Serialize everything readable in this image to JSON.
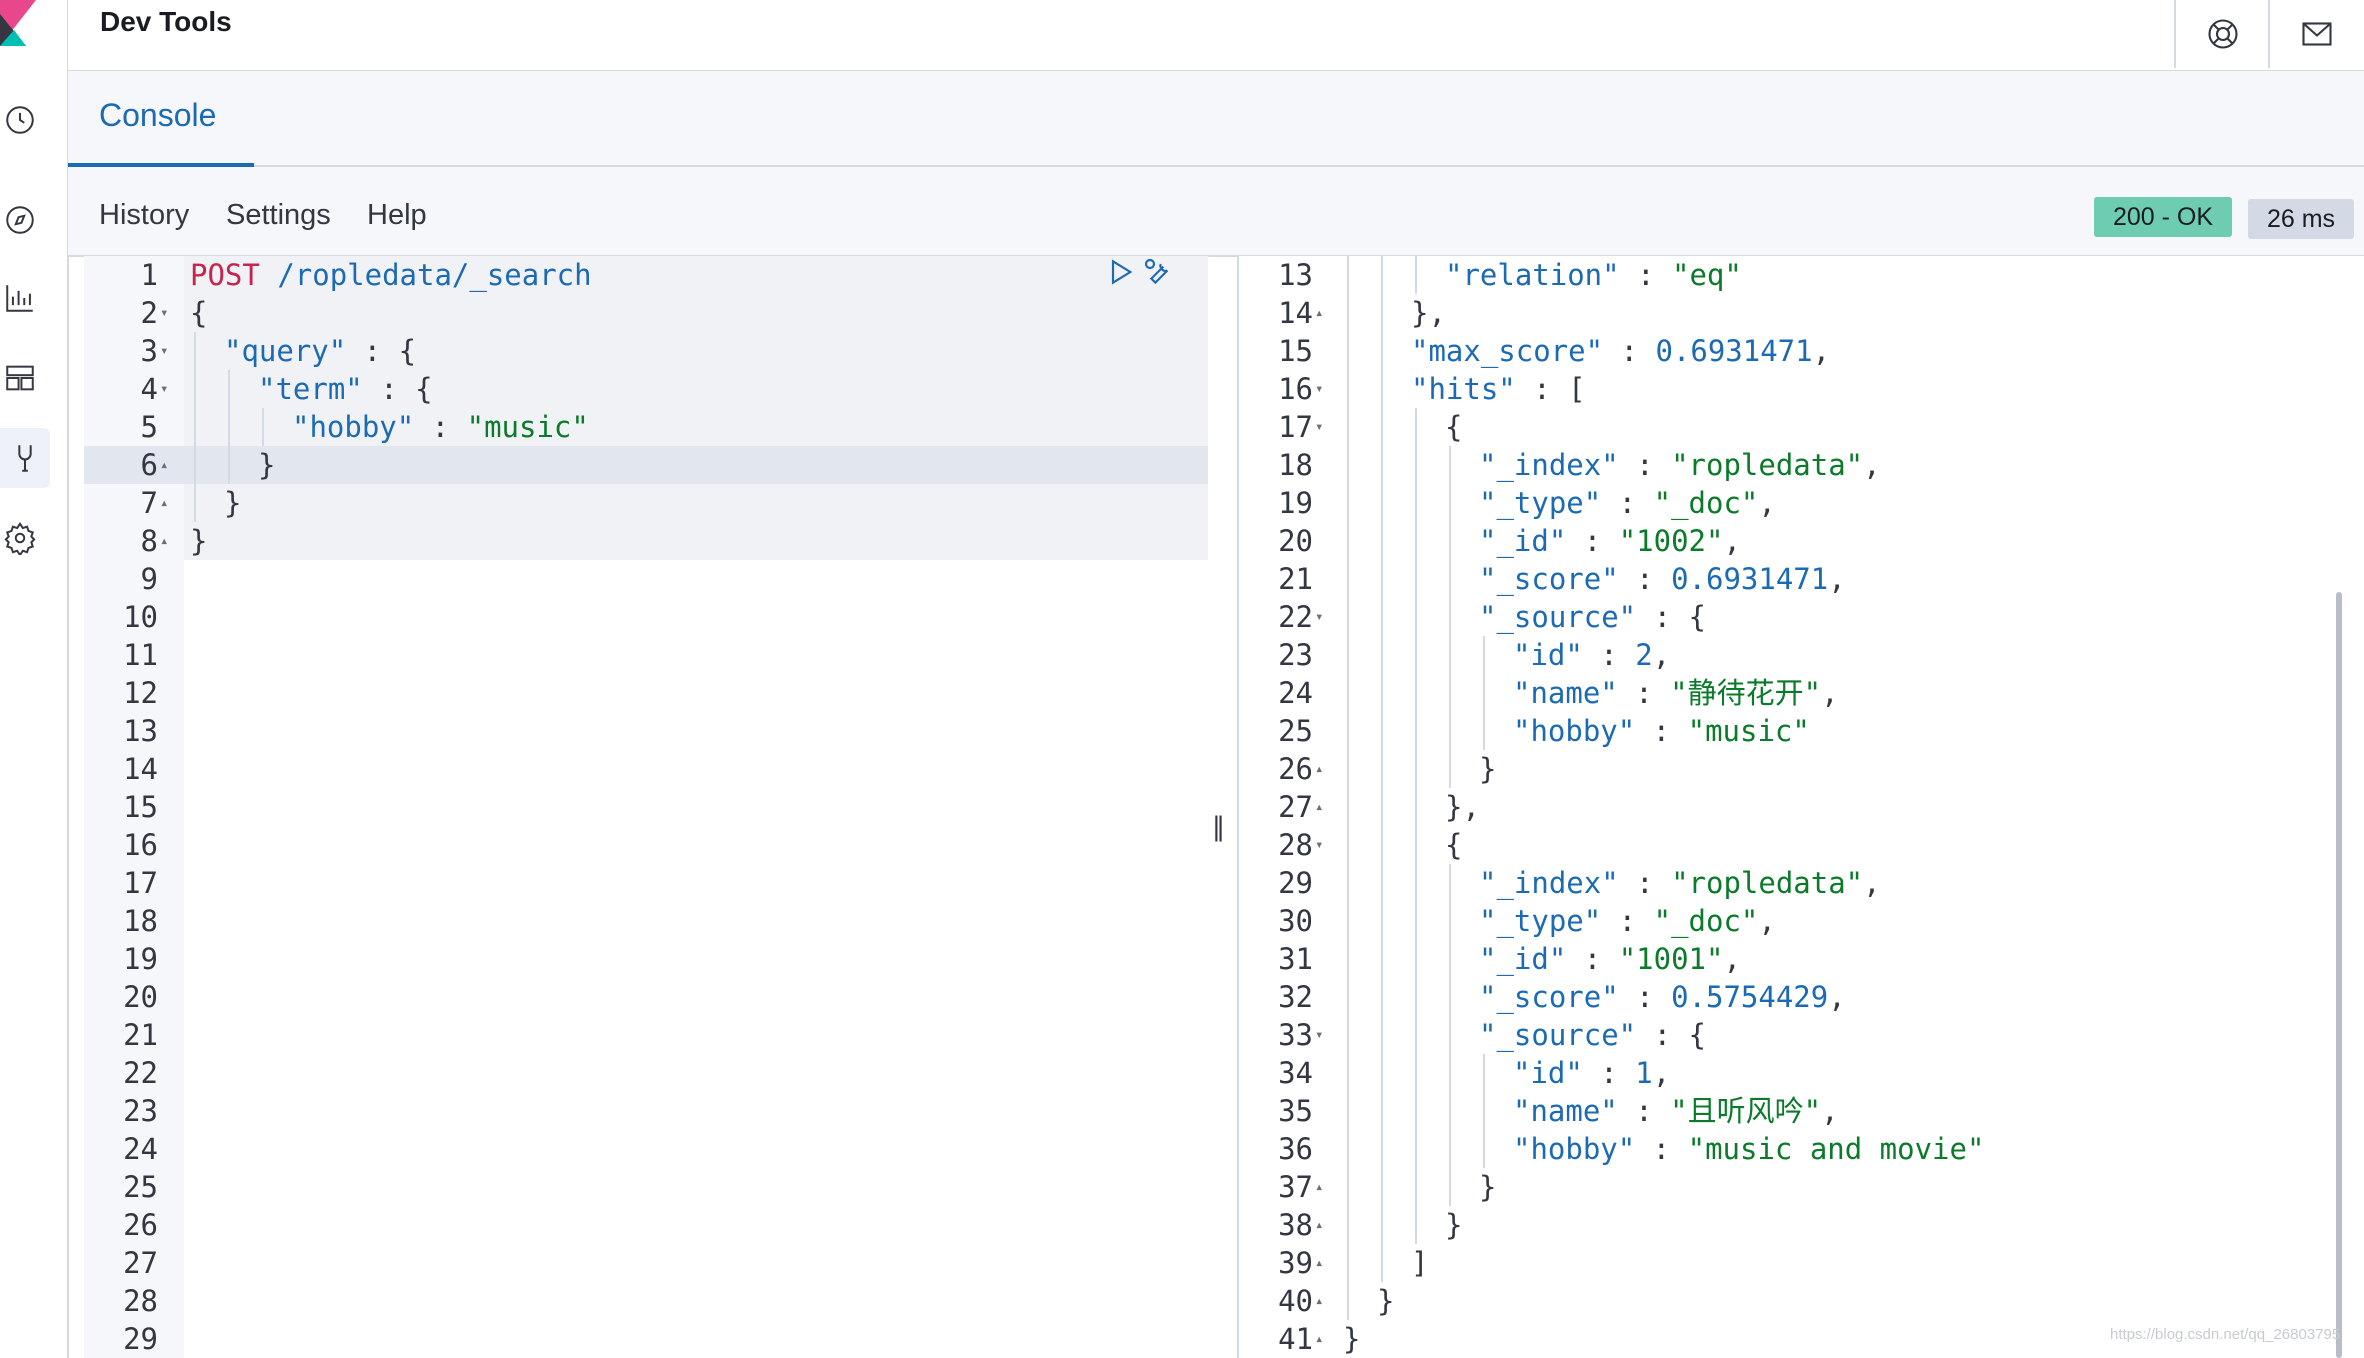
{
  "header": {
    "title": "Dev Tools"
  },
  "nav": {
    "items": [
      {
        "name": "recently-viewed-icon"
      },
      {
        "name": "discover-icon"
      },
      {
        "name": "visualize-icon"
      },
      {
        "name": "dashboard-icon"
      },
      {
        "name": "dev-tools-icon"
      },
      {
        "name": "management-icon"
      }
    ]
  },
  "tabs": {
    "active": "Console"
  },
  "menu": {
    "history": "History",
    "settings": "Settings",
    "help": "Help"
  },
  "status": {
    "code": "200 - OK",
    "time": "26 ms"
  },
  "request": {
    "lines": [
      {
        "n": "1",
        "fold": "",
        "indent": 0,
        "tokens": [
          [
            "m",
            "POST"
          ],
          [
            "p",
            " "
          ],
          [
            "k",
            "/ropledata/_search"
          ]
        ]
      },
      {
        "n": "2",
        "fold": "▾",
        "indent": 0,
        "tokens": [
          [
            "p",
            "{"
          ]
        ]
      },
      {
        "n": "3",
        "fold": "▾",
        "indent": 1,
        "tokens": [
          [
            "k",
            "\"query\""
          ],
          [
            "p",
            " : {"
          ]
        ]
      },
      {
        "n": "4",
        "fold": "▾",
        "indent": 2,
        "tokens": [
          [
            "k",
            "\"term\""
          ],
          [
            "p",
            " : {"
          ]
        ]
      },
      {
        "n": "5",
        "fold": "",
        "indent": 3,
        "tokens": [
          [
            "k",
            "\"hobby\""
          ],
          [
            "p",
            " : "
          ],
          [
            "s",
            "\"music\""
          ]
        ]
      },
      {
        "n": "6",
        "fold": "▴",
        "indent": 2,
        "tokens": [
          [
            "p",
            "}"
          ]
        ]
      },
      {
        "n": "7",
        "fold": "▴",
        "indent": 1,
        "tokens": [
          [
            "p",
            "}"
          ]
        ]
      },
      {
        "n": "8",
        "fold": "▴",
        "indent": 0,
        "tokens": [
          [
            "p",
            "}"
          ]
        ]
      },
      {
        "n": "9",
        "fold": "",
        "indent": 0,
        "tokens": []
      },
      {
        "n": "10",
        "fold": "",
        "indent": 0,
        "tokens": []
      },
      {
        "n": "11",
        "fold": "",
        "indent": 0,
        "tokens": []
      },
      {
        "n": "12",
        "fold": "",
        "indent": 0,
        "tokens": []
      },
      {
        "n": "13",
        "fold": "",
        "indent": 0,
        "tokens": []
      },
      {
        "n": "14",
        "fold": "",
        "indent": 0,
        "tokens": []
      },
      {
        "n": "15",
        "fold": "",
        "indent": 0,
        "tokens": []
      },
      {
        "n": "16",
        "fold": "",
        "indent": 0,
        "tokens": []
      },
      {
        "n": "17",
        "fold": "",
        "indent": 0,
        "tokens": []
      },
      {
        "n": "18",
        "fold": "",
        "indent": 0,
        "tokens": []
      },
      {
        "n": "19",
        "fold": "",
        "indent": 0,
        "tokens": []
      },
      {
        "n": "20",
        "fold": "",
        "indent": 0,
        "tokens": []
      },
      {
        "n": "21",
        "fold": "",
        "indent": 0,
        "tokens": []
      },
      {
        "n": "22",
        "fold": "",
        "indent": 0,
        "tokens": []
      },
      {
        "n": "23",
        "fold": "",
        "indent": 0,
        "tokens": []
      },
      {
        "n": "24",
        "fold": "",
        "indent": 0,
        "tokens": []
      },
      {
        "n": "25",
        "fold": "",
        "indent": 0,
        "tokens": []
      },
      {
        "n": "26",
        "fold": "",
        "indent": 0,
        "tokens": []
      },
      {
        "n": "27",
        "fold": "",
        "indent": 0,
        "tokens": []
      },
      {
        "n": "28",
        "fold": "",
        "indent": 0,
        "tokens": []
      },
      {
        "n": "29",
        "fold": "",
        "indent": 0,
        "tokens": []
      }
    ]
  },
  "response": {
    "lines": [
      {
        "n": "13",
        "fold": "",
        "indent": 3,
        "tokens": [
          [
            "k",
            "\"relation\""
          ],
          [
            "p",
            " : "
          ],
          [
            "s",
            "\"eq\""
          ]
        ]
      },
      {
        "n": "14",
        "fold": "▴",
        "indent": 2,
        "tokens": [
          [
            "p",
            "},"
          ]
        ]
      },
      {
        "n": "15",
        "fold": "",
        "indent": 2,
        "tokens": [
          [
            "k",
            "\"max_score\""
          ],
          [
            "p",
            " : "
          ],
          [
            "n",
            "0.6931471"
          ],
          [
            "p",
            ","
          ]
        ]
      },
      {
        "n": "16",
        "fold": "▾",
        "indent": 2,
        "tokens": [
          [
            "k",
            "\"hits\""
          ],
          [
            "p",
            " : ["
          ]
        ]
      },
      {
        "n": "17",
        "fold": "▾",
        "indent": 3,
        "tokens": [
          [
            "p",
            "{"
          ]
        ]
      },
      {
        "n": "18",
        "fold": "",
        "indent": 4,
        "tokens": [
          [
            "k",
            "\"_index\""
          ],
          [
            "p",
            " : "
          ],
          [
            "s",
            "\"ropledata\""
          ],
          [
            "p",
            ","
          ]
        ]
      },
      {
        "n": "19",
        "fold": "",
        "indent": 4,
        "tokens": [
          [
            "k",
            "\"_type\""
          ],
          [
            "p",
            " : "
          ],
          [
            "s",
            "\"_doc\""
          ],
          [
            "p",
            ","
          ]
        ]
      },
      {
        "n": "20",
        "fold": "",
        "indent": 4,
        "tokens": [
          [
            "k",
            "\"_id\""
          ],
          [
            "p",
            " : "
          ],
          [
            "s",
            "\"1002\""
          ],
          [
            "p",
            ","
          ]
        ]
      },
      {
        "n": "21",
        "fold": "",
        "indent": 4,
        "tokens": [
          [
            "k",
            "\"_score\""
          ],
          [
            "p",
            " : "
          ],
          [
            "n",
            "0.6931471"
          ],
          [
            "p",
            ","
          ]
        ]
      },
      {
        "n": "22",
        "fold": "▾",
        "indent": 4,
        "tokens": [
          [
            "k",
            "\"_source\""
          ],
          [
            "p",
            " : {"
          ]
        ]
      },
      {
        "n": "23",
        "fold": "",
        "indent": 5,
        "tokens": [
          [
            "k",
            "\"id\""
          ],
          [
            "p",
            " : "
          ],
          [
            "n",
            "2"
          ],
          [
            "p",
            ","
          ]
        ]
      },
      {
        "n": "24",
        "fold": "",
        "indent": 5,
        "tokens": [
          [
            "k",
            "\"name\""
          ],
          [
            "p",
            " : "
          ],
          [
            "s",
            "\"静待花开\""
          ],
          [
            "p",
            ","
          ]
        ]
      },
      {
        "n": "25",
        "fold": "",
        "indent": 5,
        "tokens": [
          [
            "k",
            "\"hobby\""
          ],
          [
            "p",
            " : "
          ],
          [
            "s",
            "\"music\""
          ]
        ]
      },
      {
        "n": "26",
        "fold": "▴",
        "indent": 4,
        "tokens": [
          [
            "p",
            "}"
          ]
        ]
      },
      {
        "n": "27",
        "fold": "▴",
        "indent": 3,
        "tokens": [
          [
            "p",
            "},"
          ]
        ]
      },
      {
        "n": "28",
        "fold": "▾",
        "indent": 3,
        "tokens": [
          [
            "p",
            "{"
          ]
        ]
      },
      {
        "n": "29",
        "fold": "",
        "indent": 4,
        "tokens": [
          [
            "k",
            "\"_index\""
          ],
          [
            "p",
            " : "
          ],
          [
            "s",
            "\"ropledata\""
          ],
          [
            "p",
            ","
          ]
        ]
      },
      {
        "n": "30",
        "fold": "",
        "indent": 4,
        "tokens": [
          [
            "k",
            "\"_type\""
          ],
          [
            "p",
            " : "
          ],
          [
            "s",
            "\"_doc\""
          ],
          [
            "p",
            ","
          ]
        ]
      },
      {
        "n": "31",
        "fold": "",
        "indent": 4,
        "tokens": [
          [
            "k",
            "\"_id\""
          ],
          [
            "p",
            " : "
          ],
          [
            "s",
            "\"1001\""
          ],
          [
            "p",
            ","
          ]
        ]
      },
      {
        "n": "32",
        "fold": "",
        "indent": 4,
        "tokens": [
          [
            "k",
            "\"_score\""
          ],
          [
            "p",
            " : "
          ],
          [
            "n",
            "0.5754429"
          ],
          [
            "p",
            ","
          ]
        ]
      },
      {
        "n": "33",
        "fold": "▾",
        "indent": 4,
        "tokens": [
          [
            "k",
            "\"_source\""
          ],
          [
            "p",
            " : {"
          ]
        ]
      },
      {
        "n": "34",
        "fold": "",
        "indent": 5,
        "tokens": [
          [
            "k",
            "\"id\""
          ],
          [
            "p",
            " : "
          ],
          [
            "n",
            "1"
          ],
          [
            "p",
            ","
          ]
        ]
      },
      {
        "n": "35",
        "fold": "",
        "indent": 5,
        "tokens": [
          [
            "k",
            "\"name\""
          ],
          [
            "p",
            " : "
          ],
          [
            "s",
            "\"且听风吟\""
          ],
          [
            "p",
            ","
          ]
        ]
      },
      {
        "n": "36",
        "fold": "",
        "indent": 5,
        "tokens": [
          [
            "k",
            "\"hobby\""
          ],
          [
            "p",
            " : "
          ],
          [
            "s",
            "\"music and movie\""
          ]
        ]
      },
      {
        "n": "37",
        "fold": "▴",
        "indent": 4,
        "tokens": [
          [
            "p",
            "}"
          ]
        ]
      },
      {
        "n": "38",
        "fold": "▴",
        "indent": 3,
        "tokens": [
          [
            "p",
            "}"
          ]
        ]
      },
      {
        "n": "39",
        "fold": "▴",
        "indent": 2,
        "tokens": [
          [
            "p",
            "]"
          ]
        ]
      },
      {
        "n": "40",
        "fold": "▴",
        "indent": 1,
        "tokens": [
          [
            "p",
            "}"
          ]
        ]
      },
      {
        "n": "41",
        "fold": "▴",
        "indent": 0,
        "tokens": [
          [
            "p",
            "}"
          ]
        ]
      }
    ]
  },
  "watermark": "https://blog.csdn.net/qq_26803795"
}
